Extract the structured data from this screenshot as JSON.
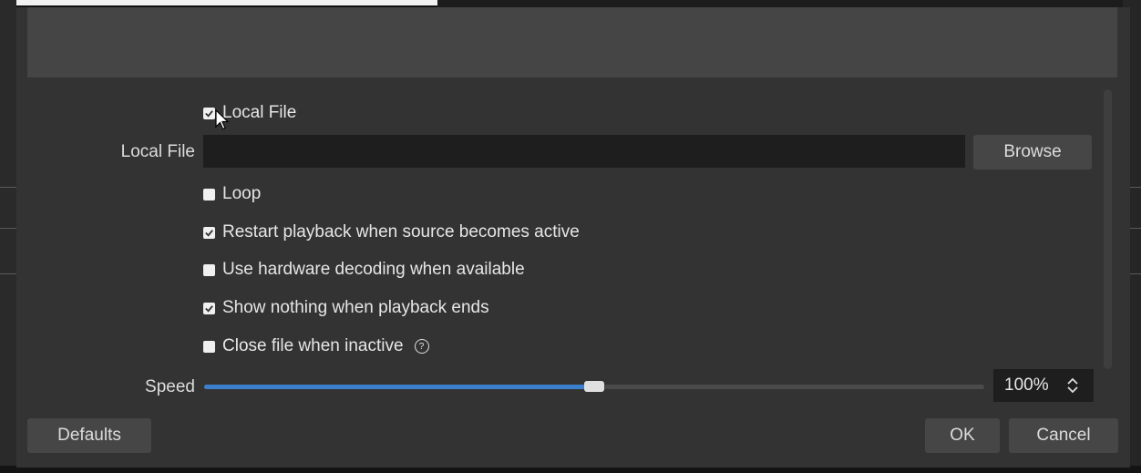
{
  "source": {
    "local_file_toggle": {
      "label": "Local File",
      "checked": true
    },
    "local_file_field": {
      "label": "Local File",
      "value": ""
    },
    "browse_label": "Browse",
    "options": [
      {
        "label": "Loop",
        "checked": false
      },
      {
        "label": "Restart playback when source becomes active",
        "checked": true
      },
      {
        "label": "Use hardware decoding when available",
        "checked": false
      },
      {
        "label": "Show nothing when playback ends",
        "checked": true
      },
      {
        "label": "Close file when inactive",
        "checked": false,
        "help": true
      }
    ],
    "speed": {
      "label": "Speed",
      "value_text": "100%",
      "slider_fraction": 0.5
    }
  },
  "footer": {
    "defaults_label": "Defaults",
    "ok_label": "OK",
    "cancel_label": "Cancel"
  },
  "colors": {
    "dialog_bg": "#333333",
    "preview_bg": "#454545",
    "accent": "#3c7fcc"
  }
}
